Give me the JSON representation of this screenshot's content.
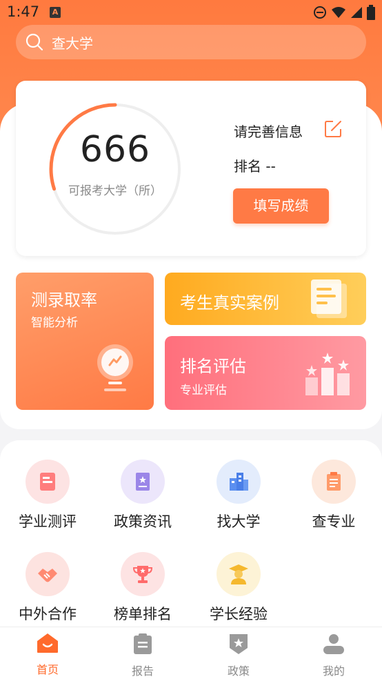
{
  "status_bar": {
    "time": "1:47",
    "notif_letter": "A"
  },
  "search": {
    "placeholder": "查大学"
  },
  "score_card": {
    "count": "666",
    "count_label": "可报考大学（所）",
    "progress": 0.3,
    "info_title": "请完善信息",
    "rank": "排名 --",
    "fill_button": "填写成绩"
  },
  "tiles": {
    "admission": {
      "title": "测录取率",
      "subtitle": "智能分析"
    },
    "cases": {
      "title": "考生真实案例"
    },
    "ranking": {
      "title": "排名评估",
      "subtitle": "专业评估"
    }
  },
  "grid": [
    {
      "label": "学业测评",
      "icon": "book-icon"
    },
    {
      "label": "政策资讯",
      "icon": "policy-book-icon"
    },
    {
      "label": "找大学",
      "icon": "building-icon"
    },
    {
      "label": "查专业",
      "icon": "clipboard-icon"
    },
    {
      "label": "中外合作",
      "icon": "handshake-icon"
    },
    {
      "label": "榜单排名",
      "icon": "trophy-icon"
    },
    {
      "label": "学长经验",
      "icon": "graduate-icon"
    }
  ],
  "tabbar": [
    {
      "label": "首页",
      "icon": "home-icon",
      "active": true
    },
    {
      "label": "报告",
      "icon": "report-icon",
      "active": false
    },
    {
      "label": "政策",
      "icon": "policy-shield-icon",
      "active": false
    },
    {
      "label": "我的",
      "icon": "user-icon",
      "active": false
    }
  ],
  "colors": {
    "accent": "#ff7a45",
    "active_tab": "#ff6a2c"
  }
}
